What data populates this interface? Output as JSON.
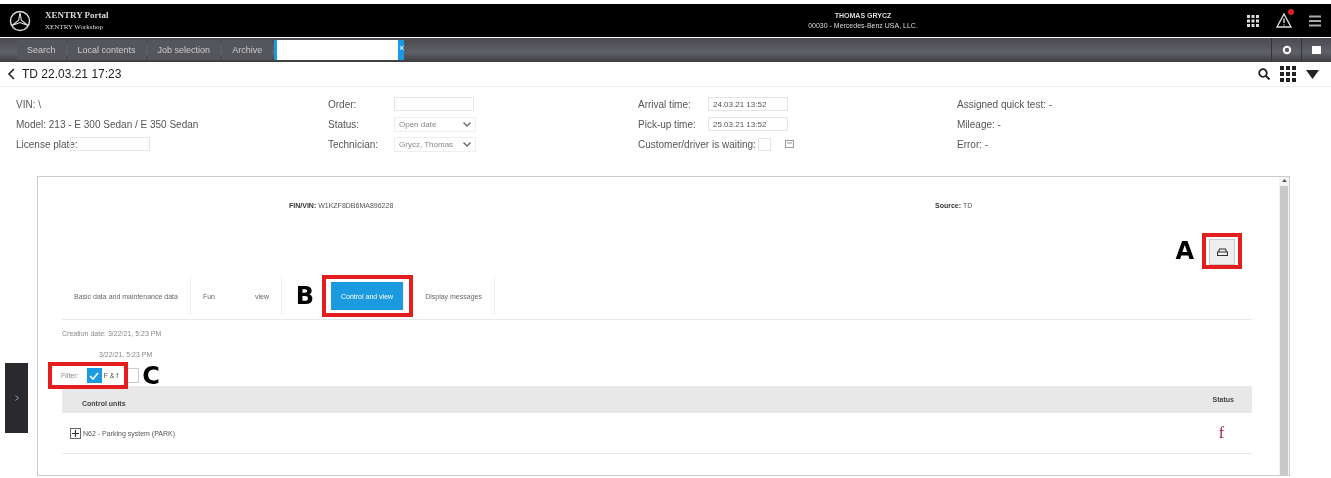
{
  "header": {
    "title": "XENTRY Portal",
    "subtitle": "XENTRY Workshop",
    "user": "THOMAS GRYCZ",
    "company": "00030 - Mercedes-Benz USA, LLC.",
    "alert": true
  },
  "nav_tabs": [
    {
      "label": "Search",
      "selected": false
    },
    {
      "label": "Local contents",
      "selected": false
    },
    {
      "label": "Job selection",
      "selected": false
    },
    {
      "label": "Archive",
      "selected": false
    },
    {
      "close": "×",
      "selected": true
    }
  ],
  "page_title": "TD 22.03.21 17:23",
  "info_columns": [
    [
      {
        "kind": "text",
        "text": "VIN: \\"
      },
      {
        "kind": "text",
        "text": "Model: 213 - E 300 Sedan / E 350 Sedan"
      },
      {
        "kind": "field",
        "label": "License plate:"
      }
    ],
    [
      {
        "kind": "field",
        "label": "Order:"
      },
      {
        "kind": "select",
        "label": "Status:",
        "value": "Open date"
      },
      {
        "kind": "select",
        "label": "Technician:",
        "value": "Grycz, Thomas"
      }
    ],
    [
      {
        "kind": "field",
        "label": "Arrival time:",
        "value": "24.03.21 13:52"
      },
      {
        "kind": "field",
        "label": "Pick-up time:",
        "value": "25.03.21 13:52"
      },
      {
        "kind": "checkbox",
        "label": "Customer/driver is waiting:",
        "checked": false
      }
    ],
    [
      {
        "kind": "text",
        "text": "Assigned quick test: -"
      },
      {
        "kind": "text",
        "text": "Mileage: -"
      },
      {
        "kind": "text",
        "text": "Error: -"
      }
    ]
  ],
  "panel": {
    "fin_vin": "**FIN/VIN:** W1KZF8DB6MA896228",
    "source": "**Source:** TD",
    "vehicle_button": {
      "callout": "A"
    },
    "tabs": [
      {
        "label": "Basic data and maintenance data",
        "selected": false
      },
      {
        "label": "Fun",
        "label_tail": "view",
        "selected": false
      },
      {
        "label": "Control and view",
        "selected": true,
        "callout": "B"
      },
      {
        "label": "Display messages",
        "selected": false
      }
    ],
    "creation_date": "Creation date: 3/22/21, 5:23 PM",
    "second_date": "3/22/21, 5:23 PM",
    "filter": {
      "label": "Filter:",
      "callout": "C",
      "options": [
        {
          "label": "F & f",
          "checked": true
        },
        {
          "checked": false
        }
      ]
    },
    "table": {
      "columns": [
        "Control units",
        "Status"
      ],
      "rows": [
        {
          "name": "N62 - Parking system (PARK)",
          "expanded": false,
          "status": "f"
        }
      ]
    }
  }
}
